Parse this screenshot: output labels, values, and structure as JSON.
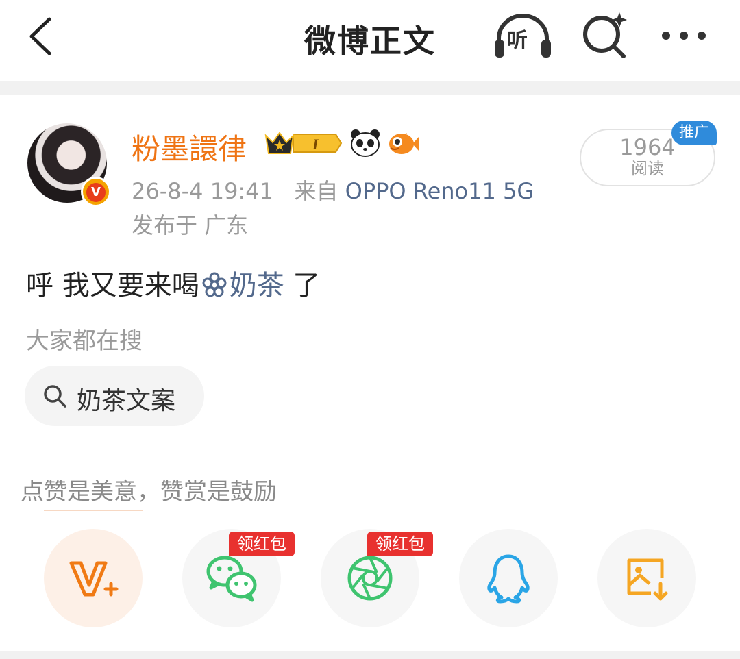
{
  "header": {
    "title": "微博正文",
    "listen_label": "听"
  },
  "author": {
    "name": "粉墨譞律",
    "time": "26-8-4 19:41",
    "from_prefix": "来自",
    "source": "OPPO Reno11 5G",
    "location": "发布于 广东"
  },
  "reads": {
    "count": "1964",
    "label": "阅读",
    "promo_tag": "推广"
  },
  "post": {
    "text_before": "呼 我又要来喝",
    "topic": "奶茶",
    "text_after": " 了"
  },
  "hot_search": {
    "title": "大家都在搜",
    "chip": "奶茶文案"
  },
  "reward": {
    "text": "点赞是美意，赞赏是鼓励"
  },
  "share": {
    "red_packet_label_1": "领红包",
    "red_packet_label_2": "领红包"
  },
  "colors": {
    "username": "#ef7414",
    "link": "#53698c",
    "promo": "#2f8bdb",
    "red_packet": "#e8312f",
    "wechat": "#3fc46f",
    "qq": "#2aa5e6",
    "save": "#f5a623"
  }
}
